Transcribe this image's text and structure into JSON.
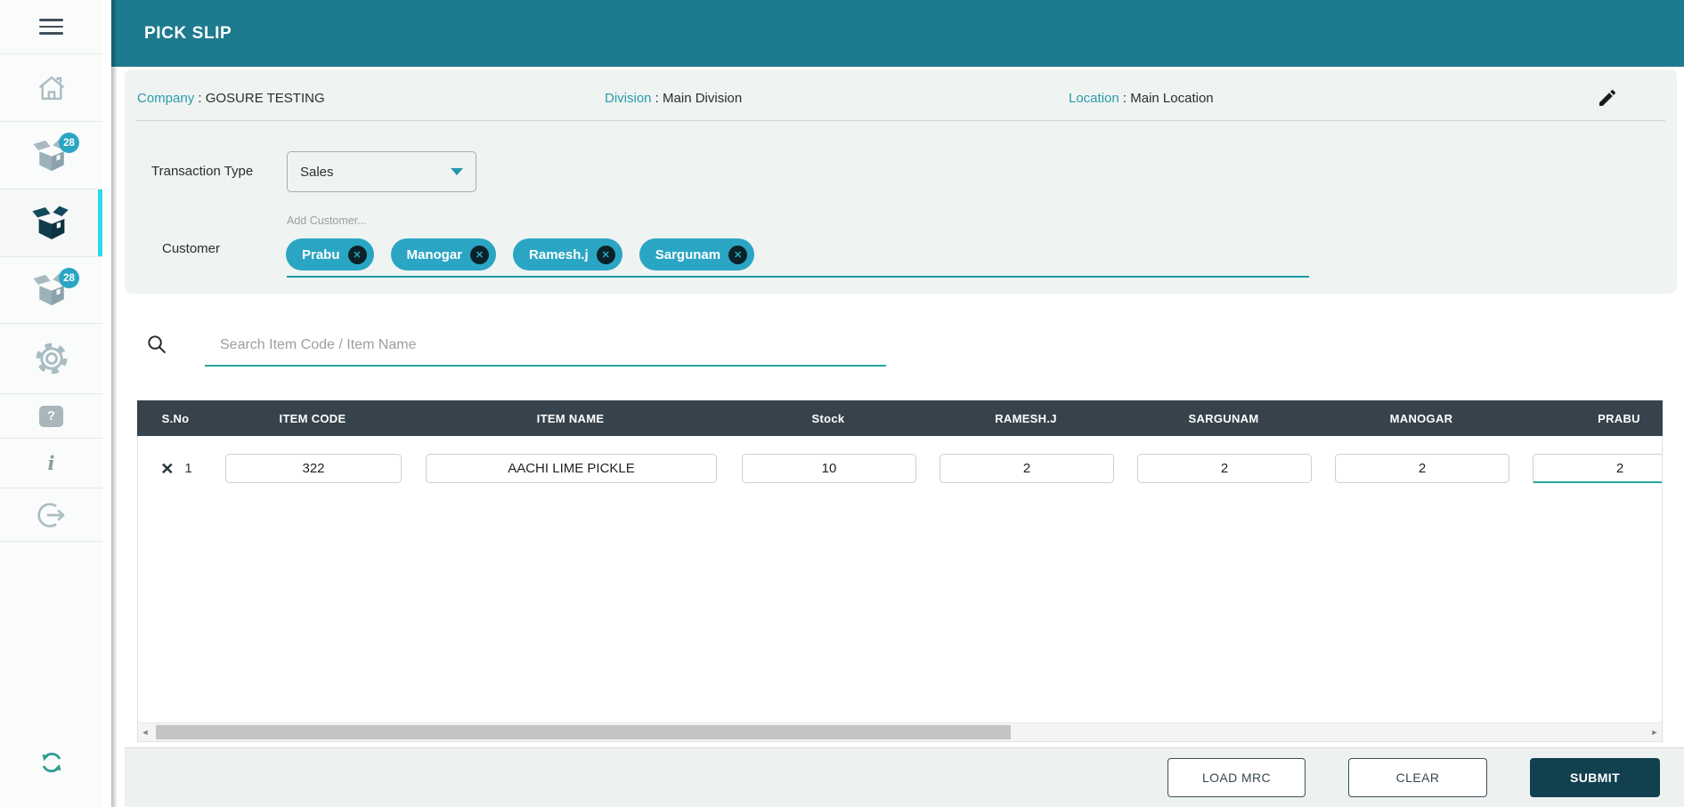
{
  "app": {
    "title": "PICK SLIP"
  },
  "sidebar": {
    "badge_top": "28",
    "badge_bottom": "28"
  },
  "icons": {
    "chip_remove": "✕",
    "row_delete": "✕",
    "help": "?",
    "info": "i",
    "scroll_left": "◄",
    "scroll_right": "►"
  },
  "info_bar": {
    "sep": " : ",
    "company_label": "Company",
    "company_value": "GOSURE TESTING",
    "division_label": "Division",
    "division_value": "Main Division",
    "location_label": "Location",
    "location_value": "Main Location"
  },
  "form": {
    "transaction_type": {
      "label": "Transaction Type",
      "value": "Sales"
    },
    "customer": {
      "label": "Customer",
      "placeholder": "Add Customer...",
      "chips": [
        "Prabu",
        "Manogar",
        "Ramesh.j",
        "Sargunam"
      ]
    }
  },
  "search": {
    "placeholder": "Search Item Code / Item Name"
  },
  "table": {
    "columns": [
      "S.No",
      "ITEM CODE",
      "ITEM NAME",
      "Stock",
      "RAMESH.J",
      "SARGUNAM",
      "MANOGAR",
      "PRABU"
    ],
    "rows": [
      {
        "sno": "1",
        "item_code": "322",
        "item_name": "AACHI LIME PICKLE",
        "stock": "10",
        "quantities": [
          "2",
          "2",
          "2",
          "2"
        ]
      }
    ]
  },
  "footer": {
    "load_mrc_label": "LOAD MRC",
    "clear_label": "CLEAR",
    "submit_label": "SUBMIT"
  },
  "colors": {
    "appbar_teal": "#1e7a8e",
    "chip_teal": "#2aa6c4",
    "table_header": "#36434c",
    "submit_dark": "#11404f",
    "focus_underline": "#26a69a",
    "customer_underline": "#189da8",
    "active_indicator": "#2bd9ea",
    "label_teal": "#2a9cab"
  }
}
